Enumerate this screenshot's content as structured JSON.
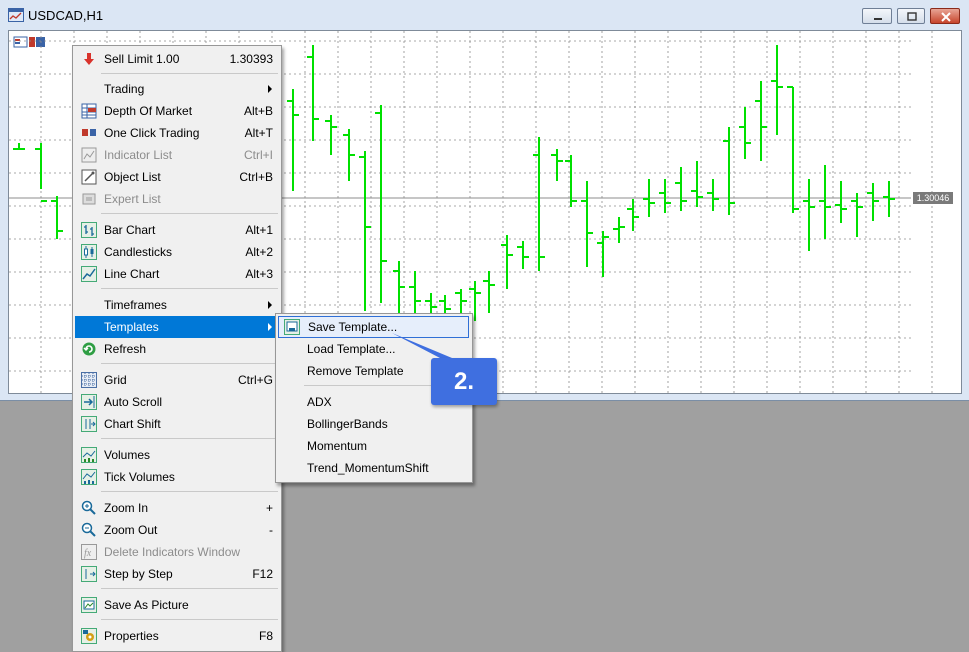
{
  "window": {
    "title": "USDCAD,H1"
  },
  "chart": {
    "current_price": "1.30046",
    "bar_color": "#00e000",
    "grid_color": "#8c8c8c",
    "price_line_color": "#8c8c8c"
  },
  "context_menu": {
    "items": [
      {
        "label": "Sell Limit 1.00",
        "shortcut": "1.30393",
        "icon": "sell-limit-icon"
      },
      {
        "label": "Trading",
        "submenu": true
      },
      {
        "label": "Depth Of Market",
        "shortcut": "Alt+B",
        "icon": "depth-of-market-icon"
      },
      {
        "label": "One Click Trading",
        "shortcut": "Alt+T",
        "icon": "one-click-trading-icon"
      },
      {
        "label": "Indicator List",
        "shortcut": "Ctrl+I",
        "icon": "indicator-list-icon",
        "disabled": true
      },
      {
        "label": "Object List",
        "shortcut": "Ctrl+B",
        "icon": "object-list-icon"
      },
      {
        "label": "Expert List",
        "icon": "expert-list-icon",
        "disabled": true
      },
      {
        "label": "Bar Chart",
        "shortcut": "Alt+1",
        "icon": "bar-chart-icon"
      },
      {
        "label": "Candlesticks",
        "shortcut": "Alt+2",
        "icon": "candlesticks-icon"
      },
      {
        "label": "Line Chart",
        "shortcut": "Alt+3",
        "icon": "line-chart-icon"
      },
      {
        "label": "Timeframes",
        "submenu": true
      },
      {
        "label": "Templates",
        "submenu": true,
        "active": true
      },
      {
        "label": "Refresh",
        "icon": "refresh-icon"
      },
      {
        "label": "Grid",
        "shortcut": "Ctrl+G",
        "icon": "grid-icon"
      },
      {
        "label": "Auto Scroll",
        "icon": "auto-scroll-icon"
      },
      {
        "label": "Chart Shift",
        "icon": "chart-shift-icon"
      },
      {
        "label": "Volumes",
        "icon": "volumes-icon"
      },
      {
        "label": "Tick Volumes",
        "icon": "tick-volumes-icon"
      },
      {
        "label": "Zoom In",
        "shortcut": "+",
        "icon": "zoom-in-icon"
      },
      {
        "label": "Zoom Out",
        "shortcut": "-",
        "icon": "zoom-out-icon"
      },
      {
        "label": "Delete Indicators Window",
        "icon": "delete-indicators-window-icon",
        "disabled": true
      },
      {
        "label": "Step by Step",
        "shortcut": "F12",
        "icon": "step-by-step-icon"
      },
      {
        "label": "Save As Picture",
        "icon": "save-as-picture-icon"
      },
      {
        "label": "Properties",
        "shortcut": "F8",
        "icon": "properties-icon"
      }
    ]
  },
  "templates_submenu": {
    "items": [
      {
        "label": "Save Template...",
        "icon": "save-template-icon"
      },
      {
        "label": "Load Template..."
      },
      {
        "label": "Remove Template"
      },
      {
        "label": "ADX"
      },
      {
        "label": "BollingerBands"
      },
      {
        "label": "Momentum"
      },
      {
        "label": "Trend_MomentumShift"
      }
    ]
  },
  "callout": {
    "label": "2."
  }
}
